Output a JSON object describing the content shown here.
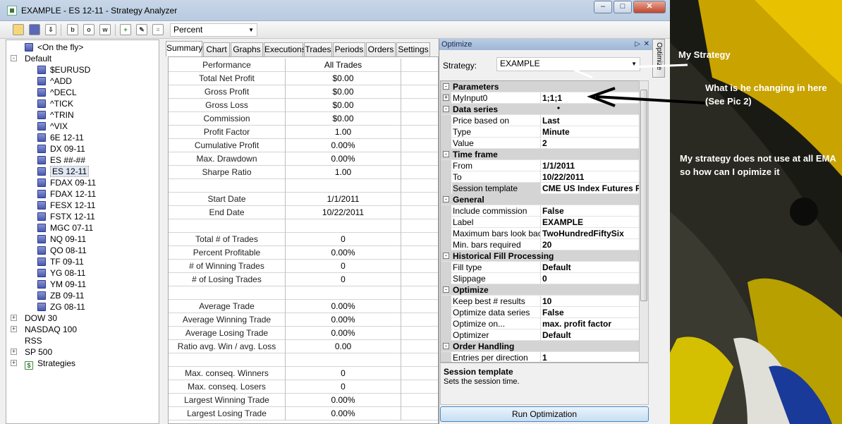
{
  "window": {
    "title": "EXAMPLE - ES 12-11 - Strategy Analyzer"
  },
  "toolbar": {
    "display_mode": "Percent"
  },
  "tree": {
    "on_the_fly": "<On the fly>",
    "default_label": "Default",
    "instruments": [
      "$EURUSD",
      "^ADD",
      "^DECL",
      "^TICK",
      "^TRIN",
      "^VIX",
      "6E 12-11",
      "DX 09-11",
      "ES ##-##",
      "ES 12-11",
      "FDAX 09-11",
      "FDAX 12-11",
      "FESX 12-11",
      "FSTX 12-11",
      "MGC 07-11",
      "NQ 09-11",
      "QO 08-11",
      "TF 09-11",
      "YG 08-11",
      "YM 09-11",
      "ZB 09-11",
      "ZG 08-11"
    ],
    "groups": [
      "DOW 30",
      "NASDAQ 100",
      "RSS",
      "SP 500",
      "Strategies"
    ]
  },
  "tabs": [
    "Summary",
    "Chart",
    "Graphs",
    "Executions",
    "Trades",
    "Periods",
    "Orders",
    "Settings"
  ],
  "summary": {
    "header": [
      "Performance",
      "All Trades"
    ],
    "rows": [
      [
        "Total Net Profit",
        "$0.00"
      ],
      [
        "Gross Profit",
        "$0.00"
      ],
      [
        "Gross Loss",
        "$0.00"
      ],
      [
        "Commission",
        "$0.00"
      ],
      [
        "Profit Factor",
        "1.00"
      ],
      [
        "Cumulative Profit",
        "0.00%"
      ],
      [
        "Max. Drawdown",
        "0.00%"
      ],
      [
        "Sharpe Ratio",
        "1.00"
      ],
      [
        "",
        ""
      ],
      [
        "Start Date",
        "1/1/2011"
      ],
      [
        "End Date",
        "10/22/2011"
      ],
      [
        "",
        ""
      ],
      [
        "Total # of Trades",
        "0"
      ],
      [
        "Percent Profitable",
        "0.00%"
      ],
      [
        "# of Winning Trades",
        "0"
      ],
      [
        "# of Losing Trades",
        "0"
      ],
      [
        "",
        ""
      ],
      [
        "Average Trade",
        "0.00%"
      ],
      [
        "Average Winning Trade",
        "0.00%"
      ],
      [
        "Average Losing Trade",
        "0.00%"
      ],
      [
        "Ratio avg. Win / avg. Loss",
        "0.00"
      ],
      [
        "",
        ""
      ],
      [
        "Max. conseq. Winners",
        "0"
      ],
      [
        "Max. conseq. Losers",
        "0"
      ],
      [
        "Largest Winning Trade",
        "0.00%"
      ],
      [
        "Largest Losing Trade",
        "0.00%"
      ]
    ]
  },
  "optimize": {
    "panel_title": "Optimize",
    "side_tab": "Optimize",
    "strategy_label": "Strategy:",
    "strategy_value": "EXAMPLE",
    "properties": [
      {
        "cat": "Parameters"
      },
      {
        "name": "MyInput0",
        "value": "1;1;1",
        "expand": true
      },
      {
        "cat": "Data series"
      },
      {
        "name": "Price based on",
        "value": "Last"
      },
      {
        "name": "Type",
        "value": "Minute"
      },
      {
        "name": "Value",
        "value": "2"
      },
      {
        "cat": "Time frame"
      },
      {
        "name": "From",
        "value": "1/1/2011"
      },
      {
        "name": "To",
        "value": "10/22/2011"
      },
      {
        "name": "Session template",
        "value": "CME US Index Futures RTH",
        "selected": true
      },
      {
        "cat": "General"
      },
      {
        "name": "Include commission",
        "value": "False"
      },
      {
        "name": "Label",
        "value": "EXAMPLE"
      },
      {
        "name": "Maximum bars look back",
        "value": "TwoHundredFiftySix"
      },
      {
        "name": "Min. bars required",
        "value": "20"
      },
      {
        "cat": "Historical Fill Processing"
      },
      {
        "name": "Fill type",
        "value": "Default"
      },
      {
        "name": "Slippage",
        "value": "0"
      },
      {
        "cat": "Optimize"
      },
      {
        "name": "Keep best # results",
        "value": "10"
      },
      {
        "name": "Optimize data series",
        "value": "False"
      },
      {
        "name": "Optimize on...",
        "value": "max. profit factor"
      },
      {
        "name": "Optimizer",
        "value": "Default"
      },
      {
        "cat": "Order Handling"
      },
      {
        "name": "Entries per direction",
        "value": "1"
      }
    ],
    "help_title": "Session template",
    "help_text": "Sets the session time.",
    "run_button": "Run Optimization"
  },
  "annotations": {
    "my_strategy": "My Strategy",
    "question1": "What is he changing in here (See Pic 2)",
    "question2": "My strategy does not use at all EMA so how can I opimize it"
  },
  "colors": {
    "annotation_arrow": "#ffffff",
    "accent": "#1a4a8a"
  }
}
